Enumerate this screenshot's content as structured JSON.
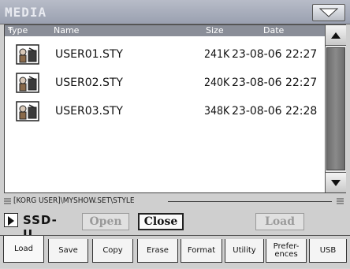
{
  "window": {
    "title": "MEDIA"
  },
  "columns": {
    "type": "Type",
    "sort": "*",
    "name": "Name",
    "size": "Size",
    "date": "Date"
  },
  "files": [
    {
      "name": "USER01.STY",
      "size": "241K",
      "date": "23-08-06 22:27",
      "icon": "style-file-icon"
    },
    {
      "name": "USER02.STY",
      "size": "240K",
      "date": "23-08-06 22:27",
      "icon": "style-file-icon"
    },
    {
      "name": "USER03.STY",
      "size": "348K",
      "date": "23-08-06 22:28",
      "icon": "style-file-icon"
    }
  ],
  "path": "[KORG USER]\\MYSHOW.SET\\STYLE",
  "device": {
    "label": "SSD-U"
  },
  "buttons": {
    "open": "Open",
    "close": "Close",
    "load": "Load"
  },
  "tabs": [
    {
      "label": "Load",
      "active": true
    },
    {
      "label": "Save"
    },
    {
      "label": "Copy"
    },
    {
      "label": "Erase"
    },
    {
      "label": "Format"
    },
    {
      "label": "Utility"
    },
    {
      "label": "Prefer-\nences"
    },
    {
      "label": "USB"
    }
  ],
  "colors": {
    "titlebar": "#9aa0b0",
    "header": "#8a8e98",
    "scroll_thumb": "#7a7a7a"
  }
}
